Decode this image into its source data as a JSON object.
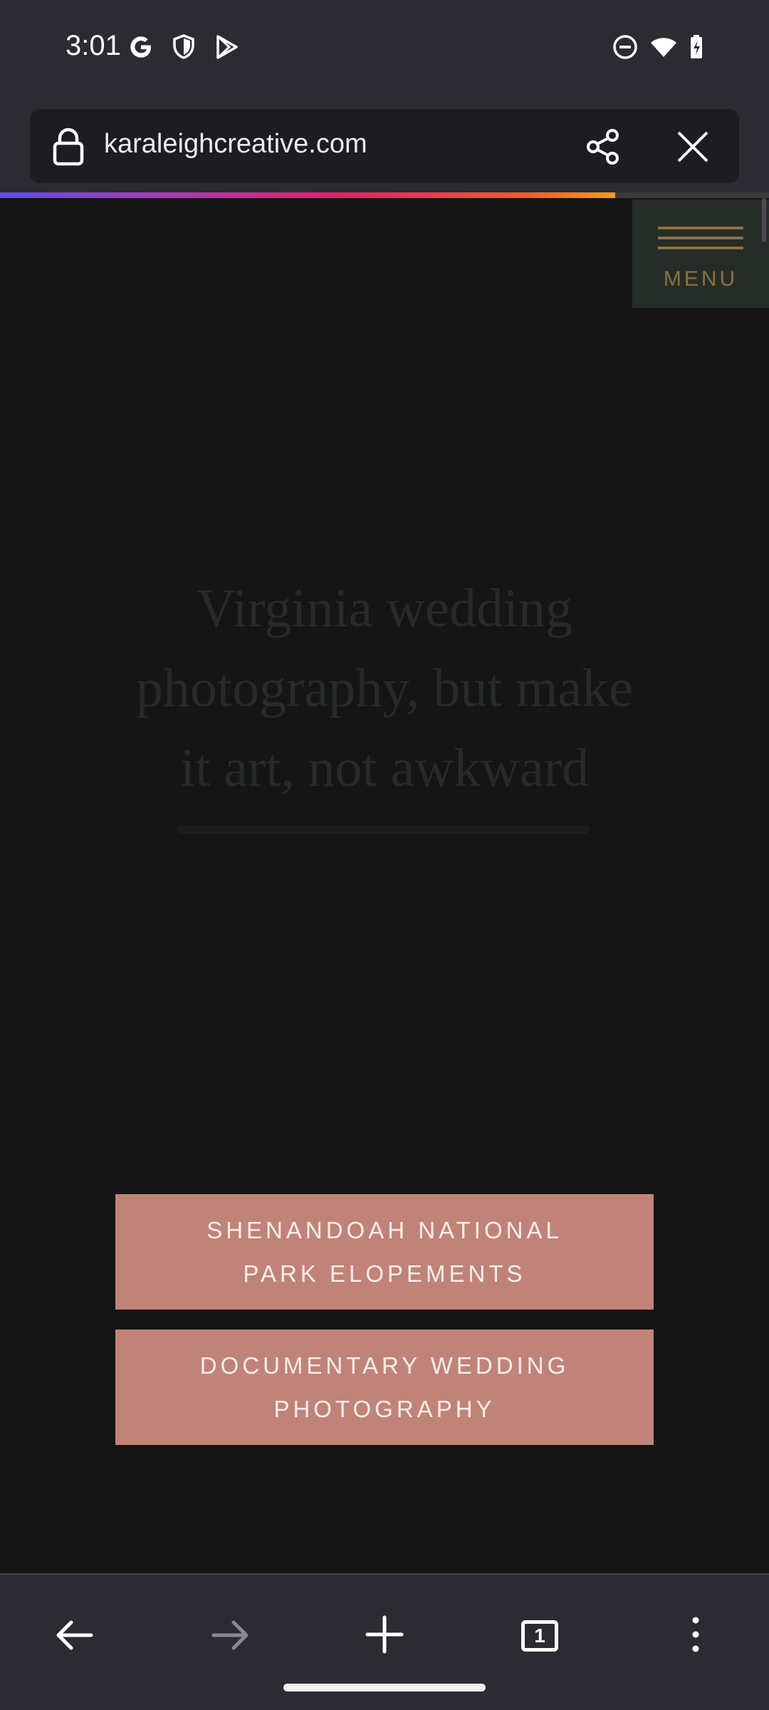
{
  "status_bar": {
    "time": "3:01",
    "left_icons": [
      "google-icon",
      "shield-icon",
      "play-store-icon"
    ],
    "right_icons": [
      "do-not-disturb-icon",
      "wifi-icon",
      "battery-charging-icon"
    ]
  },
  "browser": {
    "url": "karaleighcreative.com",
    "load_progress": 0.8,
    "actions": [
      "share-icon",
      "close-icon"
    ]
  },
  "page": {
    "menu_label": "MENU",
    "hero_title_lines": [
      "Virginia wedding",
      "photography, but make",
      "it art, not awkward"
    ],
    "buttons": [
      {
        "line1": "SHENANDOAH NATIONAL",
        "line2": "PARK ELOPEMENTS"
      },
      {
        "line1": "DOCUMENTARY WEDDING",
        "line2": "PHOTOGRAPHY"
      }
    ]
  },
  "bottom_nav": {
    "tab_count": "1",
    "items": [
      "back-icon",
      "forward-icon",
      "new-tab-icon",
      "tabs-icon",
      "more-icon"
    ]
  },
  "colors": {
    "menu_accent": "#8b7141",
    "button_bg": "#c18378",
    "page_bg": "#151516"
  }
}
